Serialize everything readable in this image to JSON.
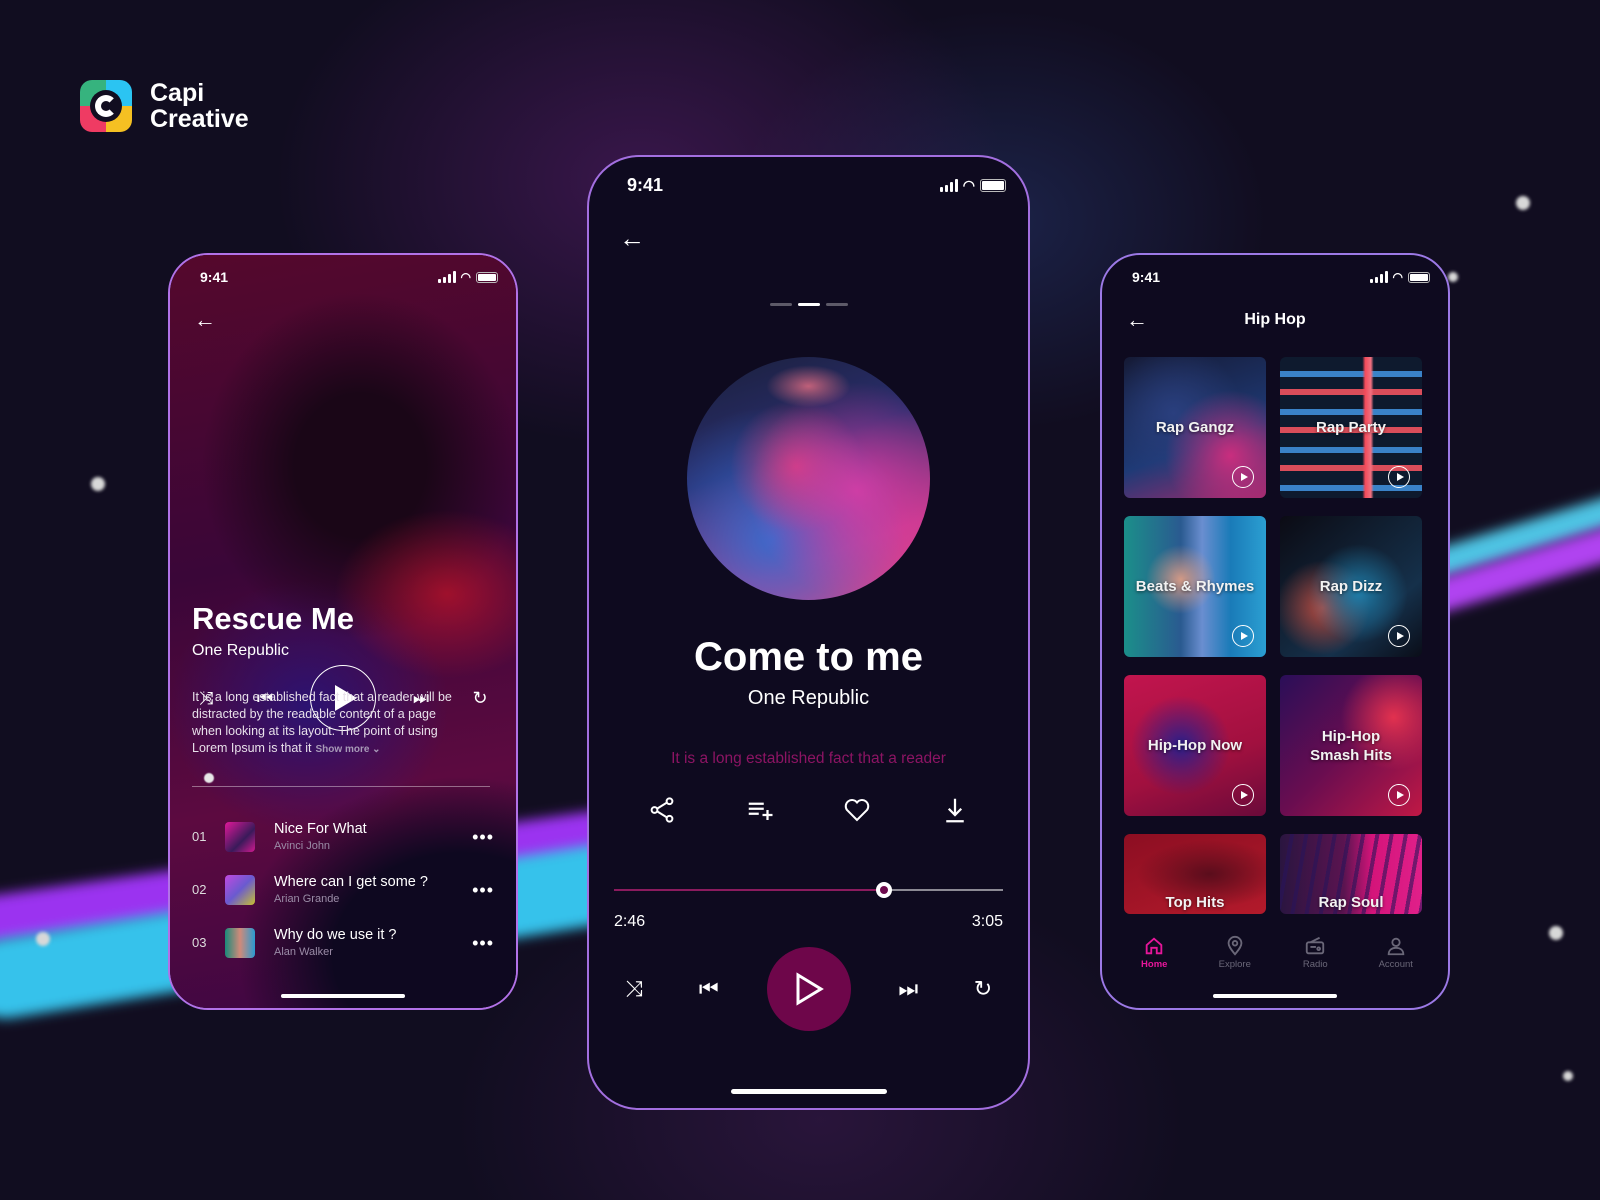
{
  "brand": {
    "name_line1": "Capi",
    "name_line2": "Creative"
  },
  "colors": {
    "accent": "#6e064a",
    "accent_pink": "#e6169a",
    "lyric": "#8c1463",
    "background": "#110d20"
  },
  "left_phone": {
    "status_time": "9:41",
    "back_icon": "arrow-left-icon",
    "song_title": "Rescue Me",
    "song_artist": "One Republic",
    "description": "It is a long established fact that a reader will be distracted by the readable content of a page when looking at its layout. The point of using Lorem Ipsum is that it",
    "show_more": "Show more ⌄",
    "controls": [
      "shuffle-icon",
      "previous-icon",
      "play-icon",
      "next-icon",
      "repeat-icon"
    ],
    "tracks": [
      {
        "number": "01",
        "title": "Nice For What",
        "artist": "Avinci John"
      },
      {
        "number": "02",
        "title": "Where can I get some ?",
        "artist": "Arian Grande"
      },
      {
        "number": "03",
        "title": "Why do we use it ?",
        "artist": "Alan Walker"
      }
    ]
  },
  "center_phone": {
    "status_time": "9:41",
    "back_icon": "arrow-left-icon",
    "pager": {
      "count": 3,
      "active_index": 1
    },
    "song_title": "Come to me",
    "song_artist": "One Republic",
    "lyric_line": "It is a long established fact that a reader",
    "actions": [
      "share-icon",
      "add-to-playlist-icon",
      "heart-icon",
      "download-icon"
    ],
    "progress": {
      "current": "2:46",
      "total": "3:05",
      "fraction": 0.695
    },
    "controls": [
      "shuffle-icon",
      "previous-icon",
      "play-icon",
      "next-icon",
      "repeat-icon"
    ]
  },
  "right_phone": {
    "status_time": "9:41",
    "back_icon": "arrow-left-icon",
    "title": "Hip Hop",
    "playlists": [
      {
        "label": "Rap Gangz"
      },
      {
        "label": "Rap Party"
      },
      {
        "label": "Beats & Rhymes"
      },
      {
        "label": "Rap Dizz"
      },
      {
        "label": "Hip-Hop Now"
      },
      {
        "label": "Hip-Hop\nSmash Hits"
      },
      {
        "label": "Top Hits"
      },
      {
        "label": "Rap Soul"
      }
    ],
    "tabs": [
      {
        "label": "Home",
        "icon": "home-icon",
        "active": true
      },
      {
        "label": "Explore",
        "icon": "location-pin-icon",
        "active": false
      },
      {
        "label": "Radio",
        "icon": "radio-icon",
        "active": false
      },
      {
        "label": "Account",
        "icon": "user-icon",
        "active": false
      }
    ]
  }
}
